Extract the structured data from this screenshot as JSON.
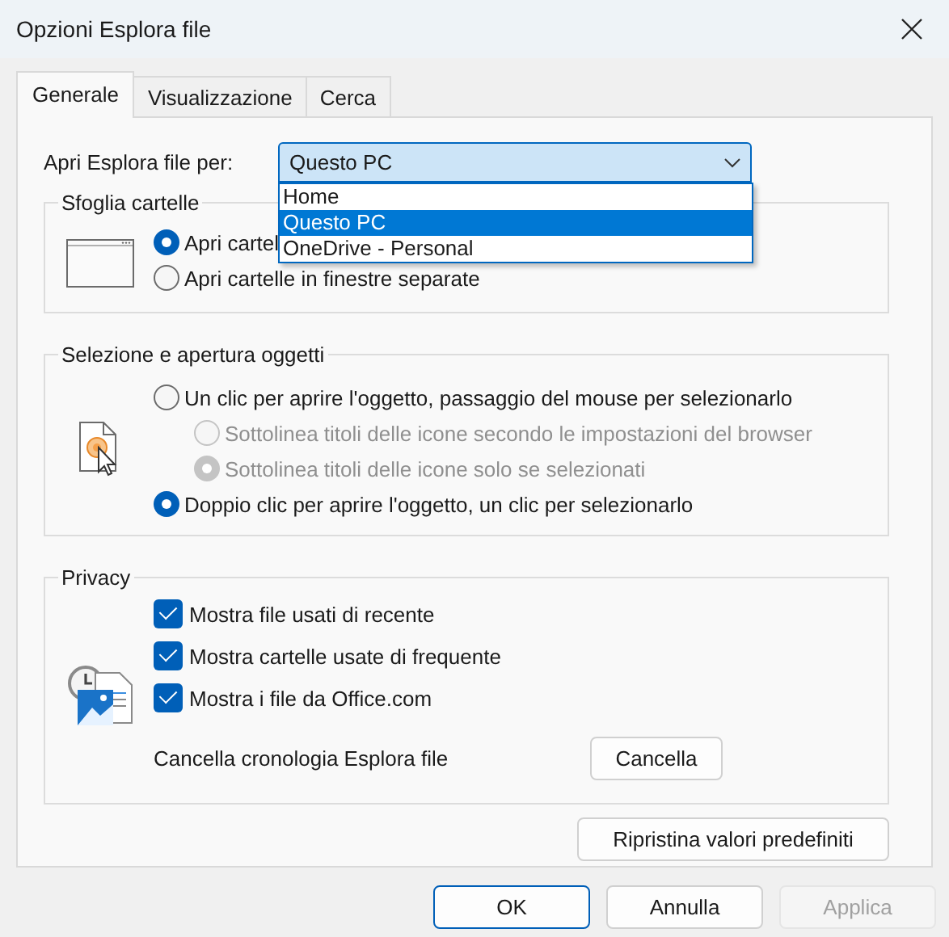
{
  "window": {
    "title": "Opzioni Esplora file"
  },
  "tabs": [
    {
      "label": "Generale",
      "selected": true
    },
    {
      "label": "Visualizzazione",
      "selected": false
    },
    {
      "label": "Cerca",
      "selected": false
    }
  ],
  "open_for": {
    "label": "Apri Esplora file per:",
    "value": "Questo PC",
    "expanded": true,
    "options": [
      {
        "label": "Home",
        "selected": false
      },
      {
        "label": "Questo PC",
        "selected": true
      },
      {
        "label": "OneDrive - Personal",
        "selected": false
      }
    ]
  },
  "groups": [
    {
      "title": "Sfoglia cartelle",
      "items": [
        {
          "kind": "radio",
          "label": "Apri cartel",
          "selected": true,
          "disabled": false
        },
        {
          "kind": "radio",
          "label": "Apri cartelle in finestre separate",
          "selected": false,
          "disabled": false
        }
      ]
    },
    {
      "title": "Selezione e apertura oggetti",
      "items": [
        {
          "kind": "radio",
          "label": "Un clic per aprire l'oggetto, passaggio del mouse per selezionarlo",
          "selected": false,
          "disabled": false,
          "children": [
            {
              "kind": "radio",
              "label": "Sottolinea titoli delle icone secondo le impostazioni del browser",
              "selected": false,
              "disabled": true
            },
            {
              "kind": "radio",
              "label": "Sottolinea titoli delle icone solo se selezionati",
              "selected": true,
              "disabled": true
            }
          ]
        },
        {
          "kind": "radio",
          "label": "Doppio clic per aprire l'oggetto, un clic per selezionarlo",
          "selected": true,
          "disabled": false
        }
      ]
    },
    {
      "title": "Privacy",
      "items": [
        {
          "kind": "checkbox",
          "label": "Mostra file usati di recente",
          "checked": true
        },
        {
          "kind": "checkbox",
          "label": "Mostra cartelle usate di frequente",
          "checked": true
        },
        {
          "kind": "checkbox",
          "label": "Mostra i file da Office.com",
          "checked": true
        },
        {
          "kind": "action",
          "label": "Cancella cronologia Esplora file",
          "button": "Cancella"
        }
      ]
    }
  ],
  "reset_button": "Ripristina valori predefiniti",
  "buttons": [
    {
      "label": "OK",
      "default": true,
      "disabled": false
    },
    {
      "label": "Annulla",
      "default": false,
      "disabled": false
    },
    {
      "label": "Applica",
      "default": false,
      "disabled": true
    }
  ]
}
